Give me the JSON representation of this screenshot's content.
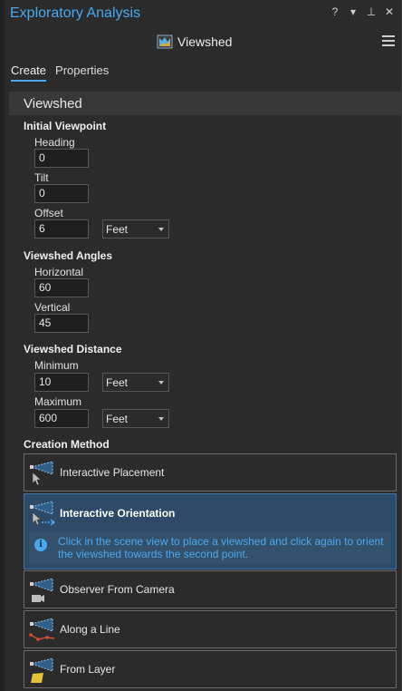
{
  "pane": {
    "title": "Exploratory Analysis",
    "controls": [
      "?",
      "▾",
      "⊥",
      "✕"
    ]
  },
  "tool": {
    "name": "Viewshed"
  },
  "tabs": [
    {
      "label": "Create",
      "active": true
    },
    {
      "label": "Properties",
      "active": false
    }
  ],
  "section": {
    "title": "Viewshed"
  },
  "initial_viewpoint": {
    "label": "Initial Viewpoint",
    "heading": {
      "label": "Heading",
      "value": "0"
    },
    "tilt": {
      "label": "Tilt",
      "value": "0"
    },
    "offset": {
      "label": "Offset",
      "value": "6",
      "unit": "Feet"
    }
  },
  "viewshed_angles": {
    "label": "Viewshed Angles",
    "horizontal": {
      "label": "Horizontal",
      "value": "60"
    },
    "vertical": {
      "label": "Vertical",
      "value": "45"
    }
  },
  "viewshed_distance": {
    "label": "Viewshed Distance",
    "minimum": {
      "label": "Minimum",
      "value": "10",
      "unit": "Feet"
    },
    "maximum": {
      "label": "Maximum",
      "value": "600",
      "unit": "Feet"
    }
  },
  "creation_method": {
    "label": "Creation Method",
    "methods": [
      {
        "label": "Interactive Placement",
        "icon": "interactive-placement-icon"
      },
      {
        "label": "Interactive Orientation",
        "icon": "interactive-orientation-icon",
        "selected": true,
        "info": "Click in the scene view to place a viewshed and click again to orient the viewshed towards the second point."
      },
      {
        "label": "Observer From Camera",
        "icon": "observer-camera-icon"
      },
      {
        "label": "Along a Line",
        "icon": "along-line-icon"
      },
      {
        "label": "From Layer",
        "icon": "from-layer-icon"
      }
    ]
  },
  "colors": {
    "accent": "#4aa8f0",
    "panel": "#2b2b2b",
    "selected": "#2e4a66"
  }
}
